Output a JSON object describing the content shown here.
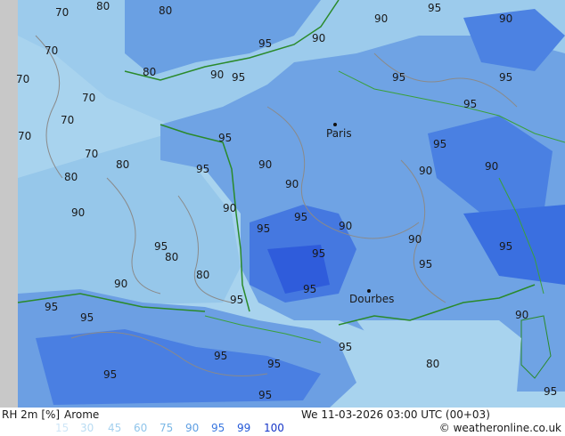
{
  "map": {
    "cities": [
      {
        "name": "Paris"
      },
      {
        "name": "Dourbes"
      }
    ],
    "contour_labels": [
      "70",
      "80",
      "90",
      "95"
    ]
  },
  "legend": {
    "param": "RH 2m [%]",
    "model": "Arome",
    "values": [
      {
        "label": "15",
        "color": "#cfe6f7"
      },
      {
        "label": "30",
        "color": "#b9dcf3"
      },
      {
        "label": "45",
        "color": "#a5d1ef"
      },
      {
        "label": "60",
        "color": "#90c5eb"
      },
      {
        "label": "75",
        "color": "#7bb8e6"
      },
      {
        "label": "90",
        "color": "#5f9fe3"
      },
      {
        "label": "95",
        "color": "#3b78e0"
      },
      {
        "label": "99",
        "color": "#2458d8"
      },
      {
        "label": "100",
        "color": "#1636c8"
      }
    ]
  },
  "datetime": "We 11-03-2026 03:00 UTC (00+03)",
  "credit": "© weatheronline.co.uk",
  "colors": {
    "sea_far": "#a9d4ef",
    "sea_mid": "#93c4ea",
    "land_90": "#6fa4e4",
    "land_95": "#4a80e2",
    "land_99": "#2f5fdb",
    "contour_gray": "#8a8a8a",
    "coast_green": "#2a8a2a",
    "border_green": "#3aa03a"
  }
}
